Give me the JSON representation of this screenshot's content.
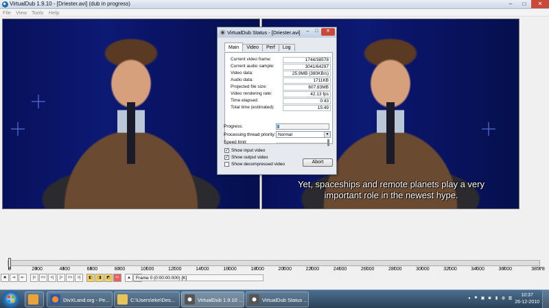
{
  "app": {
    "title": "VirtualDub 1.9.10 - [Driester.avi] (dub in progress)",
    "menu": [
      "File",
      "View",
      "Tools",
      "Help"
    ],
    "window_controls": [
      "–",
      "□",
      "✕"
    ]
  },
  "video": {
    "subtitle_lines": [
      "Yet, spaceships and remote planets play a very",
      "important role in the newest hype."
    ]
  },
  "status_dialog": {
    "title": "VirtualDub Status - [Driester.avi]",
    "tabs": [
      "Main",
      "Video",
      "Perf",
      "Log"
    ],
    "active_tab": "Main",
    "stats": [
      {
        "label": "Current video frame:",
        "value": "1744/38578"
      },
      {
        "label": "Current audio sample:",
        "value": "3041/64297"
      },
      {
        "label": "Video data:",
        "value": "25.9MB (380KB/s)"
      },
      {
        "label": "Audio data:",
        "value": "1711KB"
      },
      {
        "label": "Projected file size:",
        "value": "607.83MB"
      },
      {
        "label": "Video rendering rate:",
        "value": "42.13 fps"
      },
      {
        "label": "Time elapsed:",
        "value": "0:43"
      },
      {
        "label": "Total time (estimated):",
        "value": "15:49"
      }
    ],
    "progress_label": "Progress:",
    "progress_fraction": 0.045,
    "priority_label": "Processing thread priority:",
    "priority_value": "Normal",
    "speed_label": "Speed limit:",
    "speed_fraction": 1.0,
    "checkboxes": [
      {
        "label": "Show input video",
        "checked": true
      },
      {
        "label": "Show output video",
        "checked": true
      },
      {
        "label": "Show decompressed video",
        "checked": false
      }
    ],
    "abort_label": "Abort"
  },
  "timeline": {
    "ticks": [
      "0",
      "2000",
      "4000",
      "6000",
      "8000",
      "10000",
      "12000",
      "14000",
      "16000",
      "18000",
      "20000",
      "22000",
      "24000",
      "26000",
      "28000",
      "30000",
      "32000",
      "34000",
      "36000",
      "38578"
    ],
    "max_frame": 38578,
    "current_frame": 0,
    "frame_text": "Frame 0 (0:00:00.000) [K]"
  },
  "toolbar": {
    "buttons": [
      "■",
      "⇥",
      "⇤",
      "|<",
      "<<",
      "<|",
      "|>",
      ">>",
      ">|",
      "◧",
      "◨",
      "◩",
      "✂",
      "▲",
      "▲"
    ]
  },
  "taskbar": {
    "tasks": [
      {
        "label": "",
        "icon": "outlook-icon"
      },
      {
        "label": "DivXLand.org - Pe...",
        "icon": "browser-icon"
      },
      {
        "label": "C:\\Users\\eke\\Des...",
        "icon": "folder-icon"
      },
      {
        "label": "VirtualDub 1.9.10 ...",
        "icon": "virtualdub-icon"
      },
      {
        "label": "VirtualDub Status ...",
        "icon": "virtualdub-icon"
      }
    ],
    "tray_icons": [
      "◂",
      "⚑",
      "▣",
      "◙",
      "▮",
      "◍",
      "▥"
    ],
    "clock_time": "10:37",
    "clock_date": "26-12-2010"
  },
  "colors": {
    "taskbar": "#2b4258",
    "video_background": "#0a1257",
    "progress": "#3c8fd0",
    "close_button": "#c94a3b"
  }
}
